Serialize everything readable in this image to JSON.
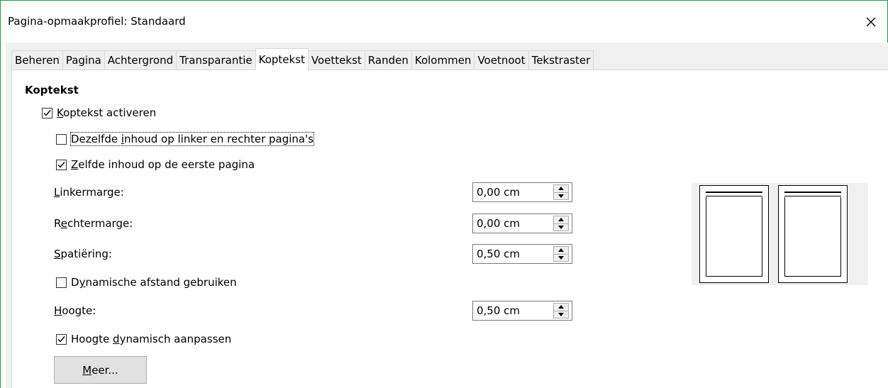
{
  "window": {
    "title": "Pagina-opmaakprofiel: Standaard"
  },
  "tabs": [
    {
      "label": "Beheren",
      "active": false
    },
    {
      "label": "Pagina",
      "active": false
    },
    {
      "label": "Achtergrond",
      "active": false
    },
    {
      "label": "Transparantie",
      "active": false
    },
    {
      "label": "Koptekst",
      "active": true
    },
    {
      "label": "Voettekst",
      "active": false
    },
    {
      "label": "Randen",
      "active": false
    },
    {
      "label": "Kolommen",
      "active": false
    },
    {
      "label": "Voetnoot",
      "active": false
    },
    {
      "label": "Tekstraster",
      "active": false
    }
  ],
  "section": {
    "heading": "Koptekst",
    "enable_header": {
      "label_accel": "K",
      "label_rest": "optekst activeren",
      "checked": true
    },
    "same_left_right": {
      "label_before": "Dezelfde ",
      "label_accel": "i",
      "label_rest": "nhoud op linker en rechter pagina's",
      "checked": false
    },
    "same_first_page": {
      "label_accel": "Z",
      "label_rest": "elfde inhoud op de eerste pagina",
      "checked": true
    },
    "left_margin": {
      "label_accel": "L",
      "label_rest": "inkermarge:",
      "value": "0,00 cm"
    },
    "right_margin": {
      "label_before": "R",
      "label_accel": "e",
      "label_rest": "chtermarge:",
      "value": "0,00 cm"
    },
    "spacing": {
      "label_accel": "S",
      "label_rest": "patiëring:",
      "value": "0,50 cm"
    },
    "dynamic_spacing": {
      "label_before": "D",
      "label_accel": "y",
      "label_rest": "namische afstand gebruiken",
      "checked": false
    },
    "height": {
      "label_accel": "H",
      "label_rest": "oogte:",
      "value": "0,50 cm"
    },
    "autofit_height": {
      "label_before": "Hoogte ",
      "label_accel": "d",
      "label_rest": "ynamisch aanpassen",
      "checked": true
    },
    "more_button": {
      "label_accel": "M",
      "label_rest": "eer..."
    }
  },
  "icons": {
    "close": "close-icon",
    "check": "checkmark-icon",
    "spin_up": "spin-up-icon",
    "spin_down": "spin-down-icon"
  }
}
